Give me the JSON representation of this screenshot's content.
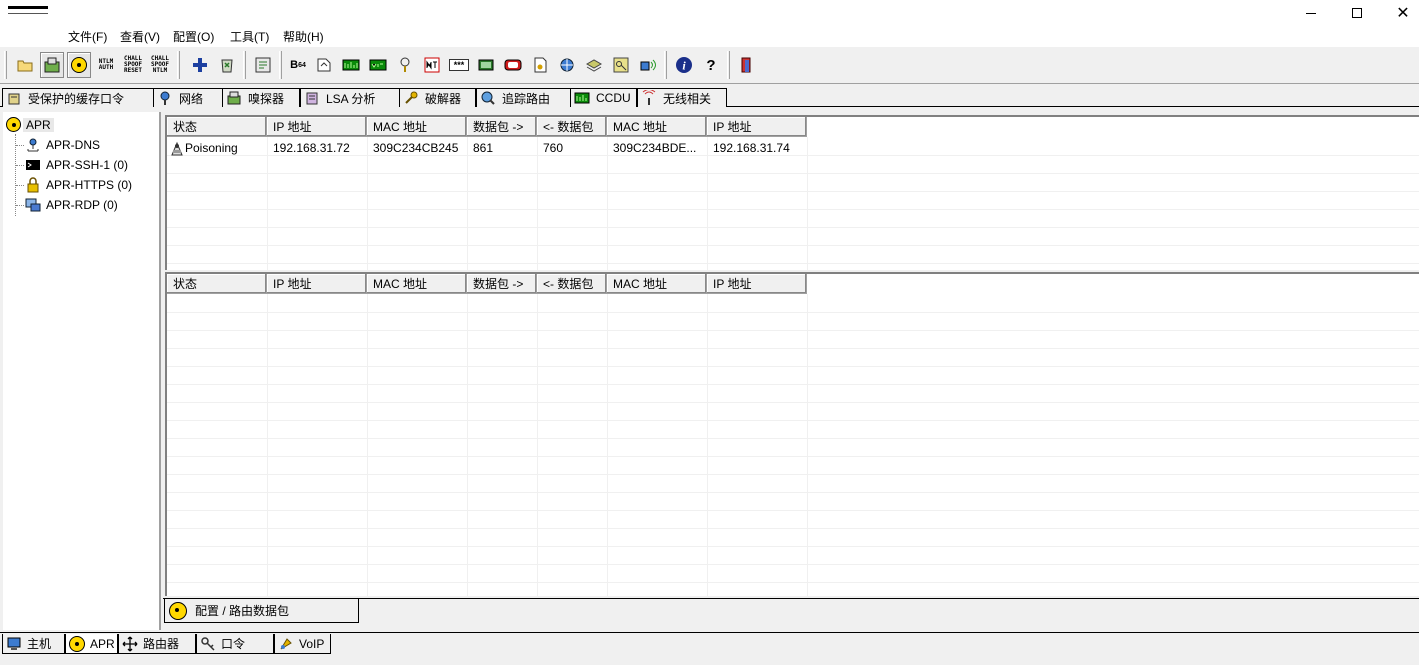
{
  "window": {
    "controls": {
      "minimize": "minimize",
      "maximize": "maximize",
      "close": "✕"
    }
  },
  "menu": [
    "文件(F)",
    "查看(V)",
    "配置(O)",
    "工具(T)",
    "帮助(H)"
  ],
  "toolbar": {
    "icons": [
      "open-folder-icon",
      "start-sniffer-icon",
      "start-apr-icon",
      "ntlm-auth-icon",
      "chall-spoof-reset-icon",
      "chall-spoof-ntlm-icon",
      "add-icon",
      "delete-icon",
      "import-icon",
      "base64-icon",
      "decode-icon",
      "vnc-icon",
      "vpn-icon",
      "wireless-icon",
      "cisco-icon",
      "password-box-icon",
      "console-icon",
      "link-icon",
      "certificate-icon",
      "network-icon",
      "hash-icon",
      "key-icon",
      "wireless-scan-icon",
      "info-icon",
      "help-icon",
      "exit-icon"
    ],
    "labels": {
      "ntlm": [
        "NTLM",
        "AUTH"
      ],
      "reset": [
        "CHALL",
        "SPOOF",
        "RESET"
      ],
      "chntlm": [
        "CHALL",
        "SPOOF",
        "NTLM"
      ],
      "b64": "B",
      "b64sub": "64",
      "stars": "***"
    }
  },
  "top_tabs": [
    {
      "label": "受保护的缓存口令",
      "icon": "cache-password-icon"
    },
    {
      "label": "网络",
      "icon": "network-icon"
    },
    {
      "label": "嗅探器",
      "icon": "sniffer-icon"
    },
    {
      "label": "LSA 分析",
      "icon": "lsa-icon"
    },
    {
      "label": "破解器",
      "icon": "cracker-icon"
    },
    {
      "label": "追踪路由",
      "icon": "traceroute-icon"
    },
    {
      "label": "CCDU",
      "icon": "ccdu-icon"
    },
    {
      "label": "无线相关",
      "icon": "wireless-icon"
    }
  ],
  "tree": {
    "root": "APR",
    "items": [
      {
        "label": "APR-DNS",
        "icon": "dns-icon"
      },
      {
        "label": "APR-SSH-1 (0)",
        "icon": "ssh-terminal-icon"
      },
      {
        "label": "APR-HTTPS (0)",
        "icon": "lock-icon"
      },
      {
        "label": "APR-RDP (0)",
        "icon": "rdp-icon"
      }
    ]
  },
  "top_table": {
    "columns": [
      "状态",
      "IP 地址",
      "MAC 地址",
      "数据包 ->",
      "<- 数据包",
      "MAC 地址",
      "IP 地址"
    ],
    "rows": [
      [
        "Poisoning",
        "192.168.31.72",
        "309C234CB245",
        "861",
        "760",
        "309C234BDE...",
        "192.168.31.74"
      ]
    ]
  },
  "bottom_table": {
    "columns": [
      "状态",
      "IP 地址",
      "MAC 地址",
      "数据包 ->",
      "<- 数据包",
      "MAC 地址",
      "IP 地址"
    ],
    "rows": []
  },
  "inner_tab": {
    "label": "配置 / 路由数据包",
    "icon": "apr-radiation-icon"
  },
  "bottom_tabs": [
    {
      "label": "主机",
      "icon": "host-icon"
    },
    {
      "label": "APR",
      "icon": "apr-radiation-icon"
    },
    {
      "label": "路由器",
      "icon": "router-icon"
    },
    {
      "label": "口令",
      "icon": "password-icon"
    },
    {
      "label": "VoIP",
      "icon": "voip-icon"
    }
  ]
}
